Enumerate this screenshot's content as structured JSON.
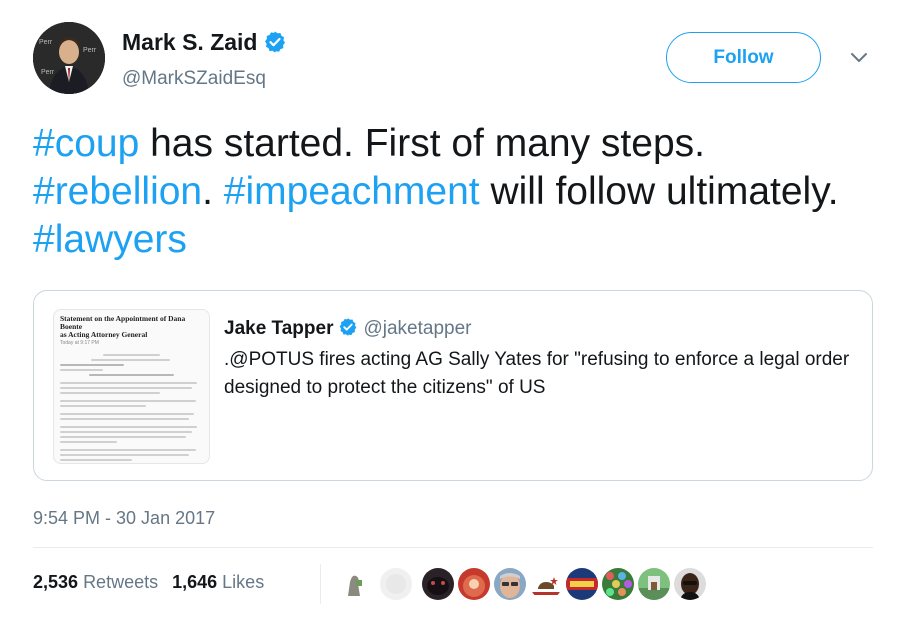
{
  "author": {
    "name": "Mark S. Zaid",
    "handle": "@MarkSZaidEsq",
    "verified": true,
    "avatar_icon": "profile-photo"
  },
  "follow_button": {
    "label": "Follow"
  },
  "menu_icon": "chevron-down-icon",
  "tweet": {
    "segments": [
      {
        "text": "#coup",
        "hashtag": true
      },
      {
        "text": " has started. First of many steps. ",
        "hashtag": false
      },
      {
        "text": "#rebellion",
        "hashtag": true
      },
      {
        "text": ". ",
        "hashtag": false
      },
      {
        "text": "#impeachment",
        "hashtag": true
      },
      {
        "text": " will follow ultimately. ",
        "hashtag": false
      },
      {
        "text": "#lawyers",
        "hashtag": true
      }
    ]
  },
  "quoted_tweet": {
    "author_name": "Jake Tapper",
    "author_handle": "@jaketapper",
    "verified": true,
    "text": ".@POTUS fires acting AG Sally Yates  for \"refusing to enforce a legal order designed to protect the citizens\" of US",
    "image": {
      "title_line1": "Statement on the Appointment of Dana Boente",
      "title_line2": "as Acting Attorney General",
      "subtitle": "Today at 9:17 PM"
    }
  },
  "timestamp": "9:54 PM - 30 Jan 2017",
  "stats": {
    "retweets_count": "2,536",
    "retweets_label": "Retweets",
    "likes_count": "1,646",
    "likes_label": "Likes"
  },
  "colors": {
    "accent": "#1da1f2",
    "secondary_text": "#657786",
    "primary_text": "#14171a",
    "border": "#ccd6dd"
  }
}
